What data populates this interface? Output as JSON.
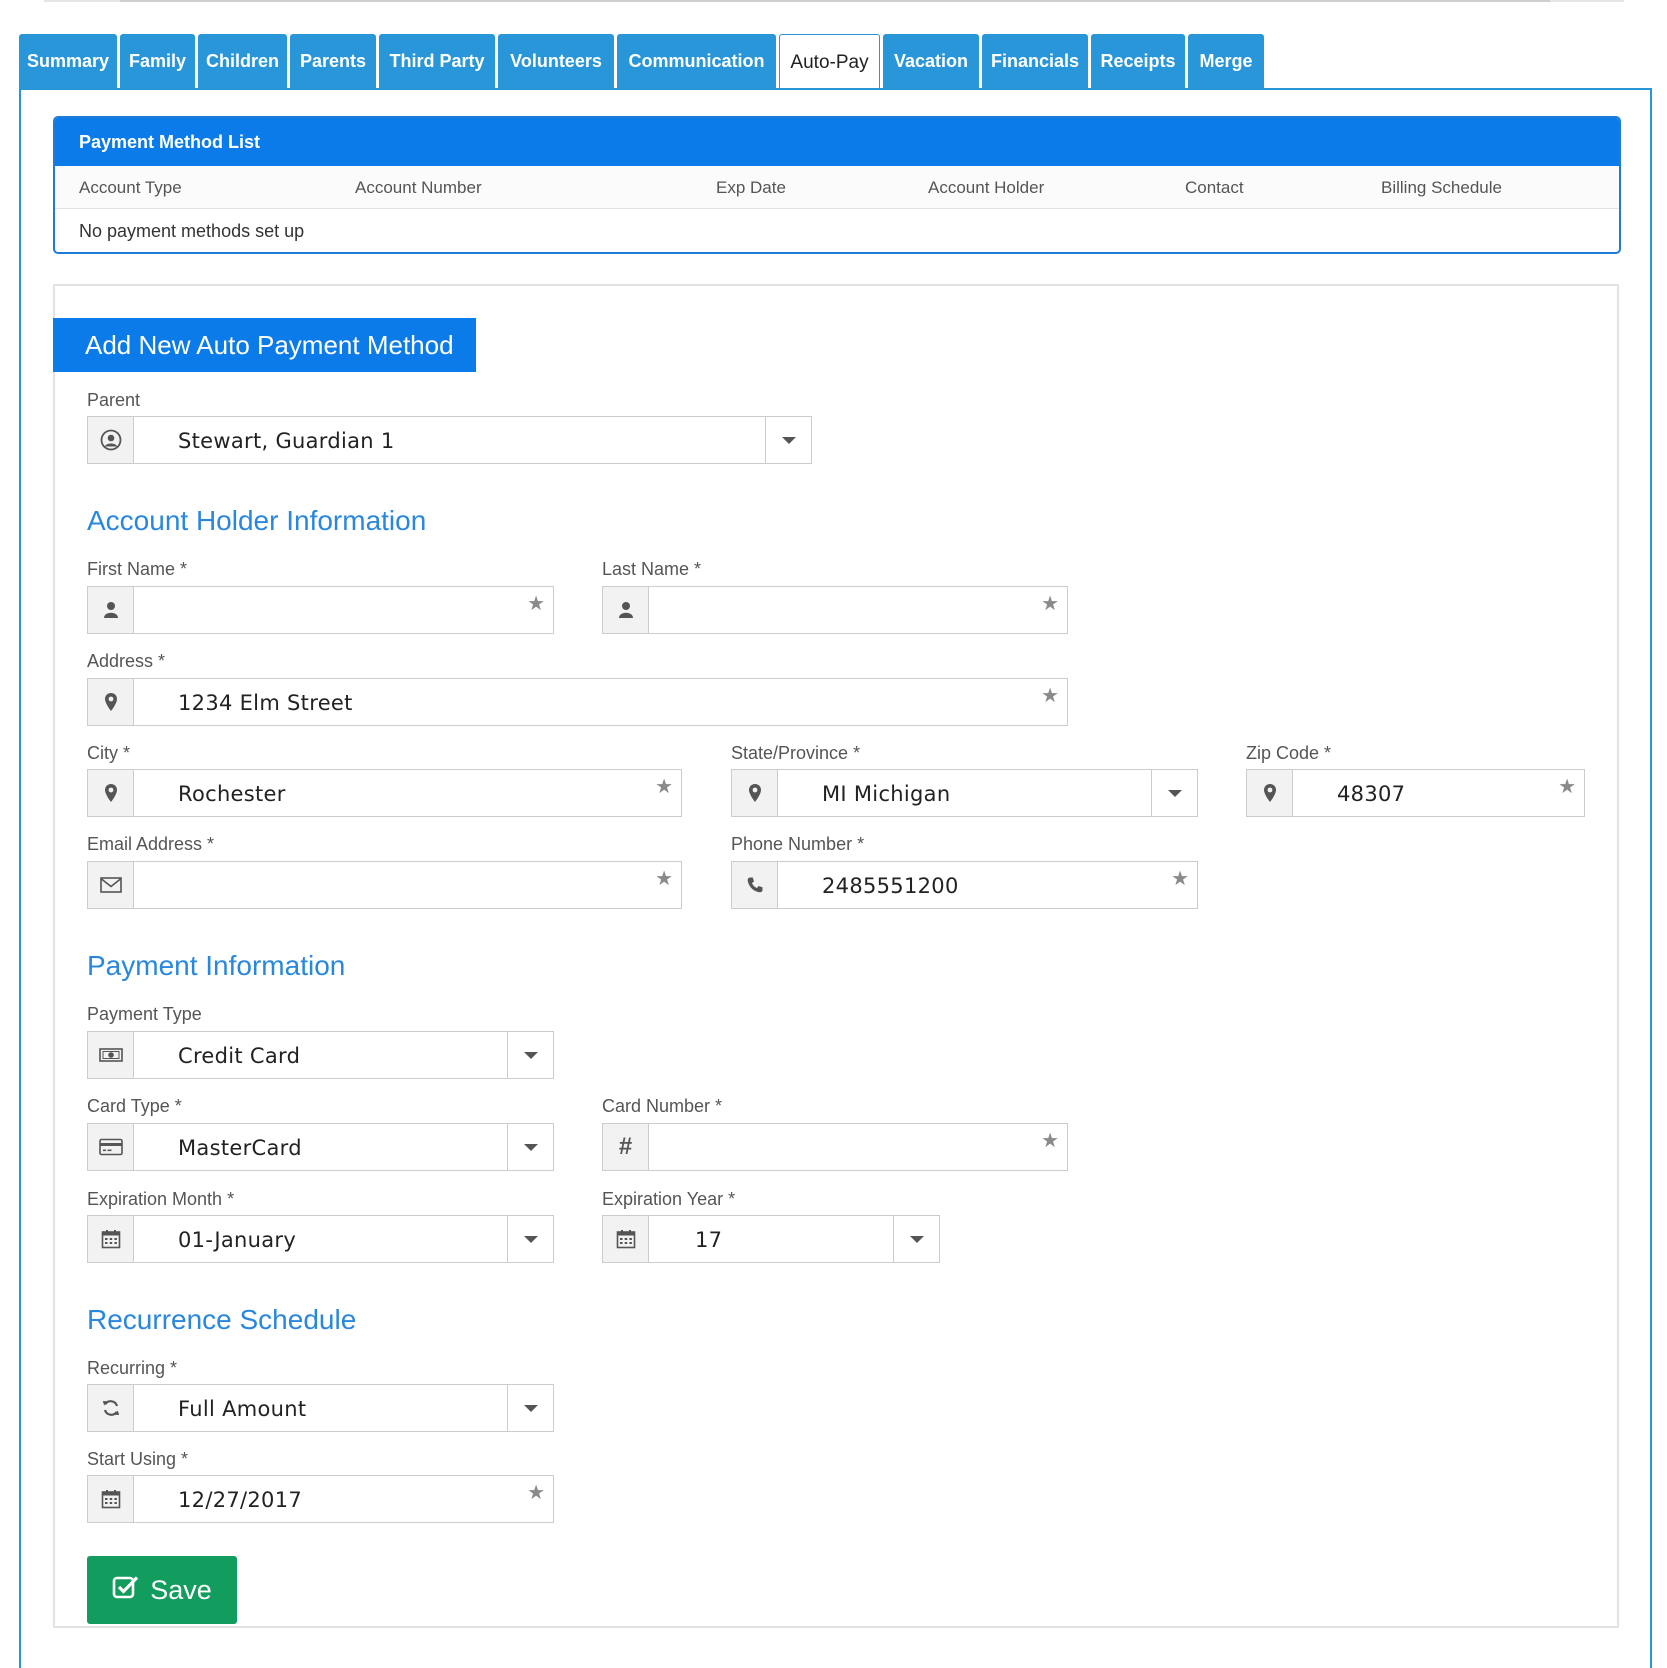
{
  "tabs": [
    {
      "label": "Summary"
    },
    {
      "label": "Family"
    },
    {
      "label": "Children"
    },
    {
      "label": "Parents"
    },
    {
      "label": "Third Party"
    },
    {
      "label": "Volunteers"
    },
    {
      "label": "Communication"
    },
    {
      "label": "Auto-Pay",
      "active": true
    },
    {
      "label": "Vacation"
    },
    {
      "label": "Financials"
    },
    {
      "label": "Receipts"
    },
    {
      "label": "Merge"
    }
  ],
  "payment_method_list": {
    "title": "Payment Method List",
    "columns": [
      "Account Type",
      "Account Number",
      "Exp Date",
      "Account Holder",
      "Contact",
      "Billing Schedule"
    ],
    "empty_message": "No payment methods set up"
  },
  "form": {
    "title": "Add New Auto Payment Method",
    "parent": {
      "label": "Parent",
      "value": "Stewart, Guardian 1",
      "icon": "user-circle-icon"
    },
    "account_holder_section": "Account Holder Information",
    "first_name": {
      "label": "First Name *",
      "value": "",
      "icon": "user-icon"
    },
    "last_name": {
      "label": "Last Name *",
      "value": "",
      "icon": "user-icon"
    },
    "address": {
      "label": "Address *",
      "value": "1234 Elm Street",
      "icon": "map-marker-icon"
    },
    "city": {
      "label": "City *",
      "value": "Rochester",
      "icon": "map-marker-icon"
    },
    "state": {
      "label": "State/Province *",
      "value": "MI Michigan",
      "icon": "map-marker-icon"
    },
    "zip": {
      "label": "Zip Code *",
      "value": "48307",
      "icon": "map-marker-icon"
    },
    "email": {
      "label": "Email Address *",
      "value": "",
      "icon": "envelope-icon"
    },
    "phone": {
      "label": "Phone Number *",
      "value": "2485551200",
      "icon": "phone-icon"
    },
    "payment_section": "Payment Information",
    "payment_type": {
      "label": "Payment Type",
      "value": "Credit Card",
      "icon": "money-icon"
    },
    "card_type": {
      "label": "Card Type *",
      "value": "MasterCard",
      "icon": "credit-card-icon"
    },
    "card_number": {
      "label": "Card Number *",
      "value": "",
      "icon": "hash-icon"
    },
    "exp_month": {
      "label": "Expiration Month *",
      "value": "01-January",
      "icon": "calendar-icon"
    },
    "exp_year": {
      "label": "Expiration Year *",
      "value": "17",
      "icon": "calendar-icon"
    },
    "recurrence_section": "Recurrence Schedule",
    "recurring": {
      "label": "Recurring *",
      "value": "Full Amount",
      "icon": "refresh-icon"
    },
    "start_using": {
      "label": "Start Using *",
      "value": "12/27/2017",
      "icon": "calendar-icon"
    },
    "save_label": "Save"
  },
  "colors": {
    "tab_blue": "#2896d8",
    "header_blue": "#0a7be8",
    "section_title_blue": "#2a87de",
    "save_green": "#129c5e"
  }
}
